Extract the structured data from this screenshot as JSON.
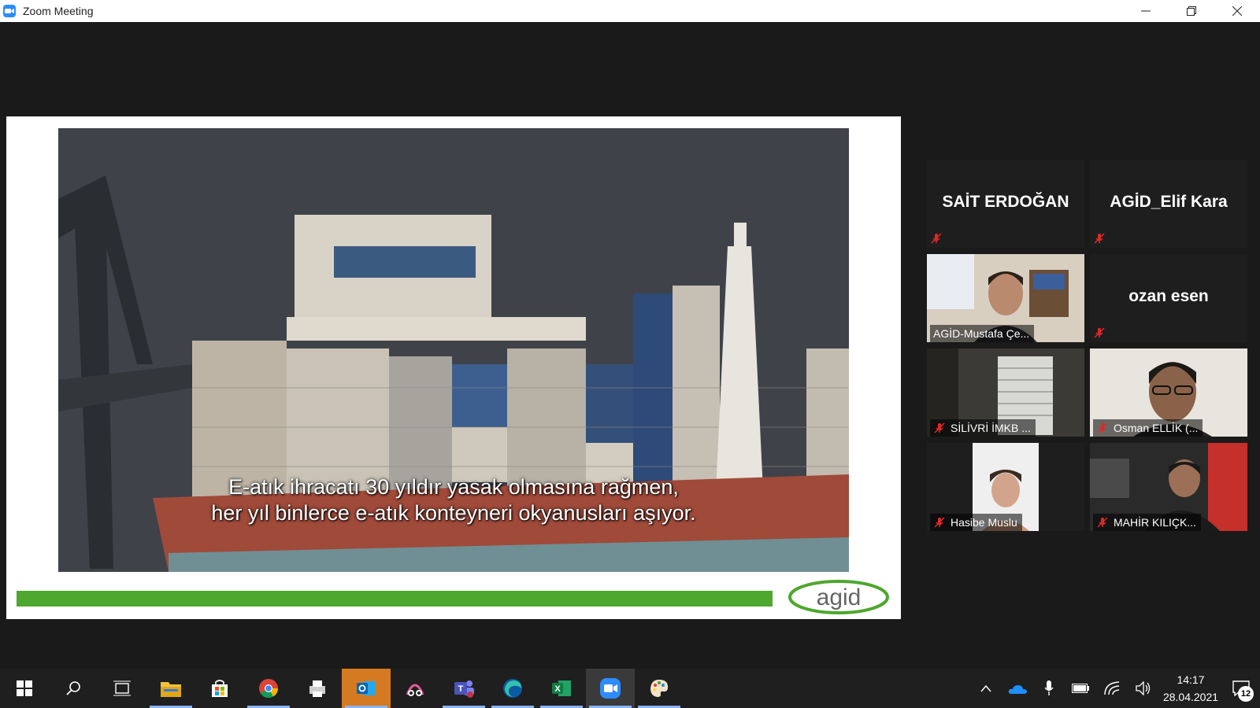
{
  "window": {
    "title": "Zoom Meeting"
  },
  "share": {
    "subtitle_line1": "E-atık ihracatı 30 yıldır yasak olmasına rağmen,",
    "subtitle_line2": "her yıl binlerce e-atık konteyneri okyanusları aşıyor.",
    "logo_text": "agid",
    "accent_color": "#4ea72e"
  },
  "participants": [
    {
      "name": "SAİT ERDOĞAN",
      "video": false,
      "muted": true
    },
    {
      "name": "AGİD_Elif Kara",
      "video": false,
      "muted": true
    },
    {
      "name": "AGİD-Mustafa Çe...",
      "video": true,
      "muted": false
    },
    {
      "name": "ozan esen",
      "video": false,
      "muted": true
    },
    {
      "name": "SİLİVRİ İMKB ...",
      "video": true,
      "muted": true
    },
    {
      "name": "Osman ELLİK (...",
      "video": true,
      "muted": true
    },
    {
      "name": "Hasibe Muslu",
      "video": true,
      "muted": true
    },
    {
      "name": "MAHİR KILIÇK...",
      "video": true,
      "muted": true
    }
  ],
  "taskbar": {
    "apps": [
      "start-icon",
      "search-icon",
      "task-view-icon",
      "file-explorer-icon",
      "store-icon",
      "chrome-icon",
      "printer-app-icon",
      "outlook-icon",
      "snip-icon",
      "teams-icon",
      "edge-icon",
      "excel-icon",
      "zoom-icon",
      "paint-icon"
    ],
    "time": "14:17",
    "date": "28.04.2021",
    "notifications": "12"
  },
  "colors": {
    "zoom_blue": "#2d8cff",
    "mute_red": "#e02828"
  }
}
